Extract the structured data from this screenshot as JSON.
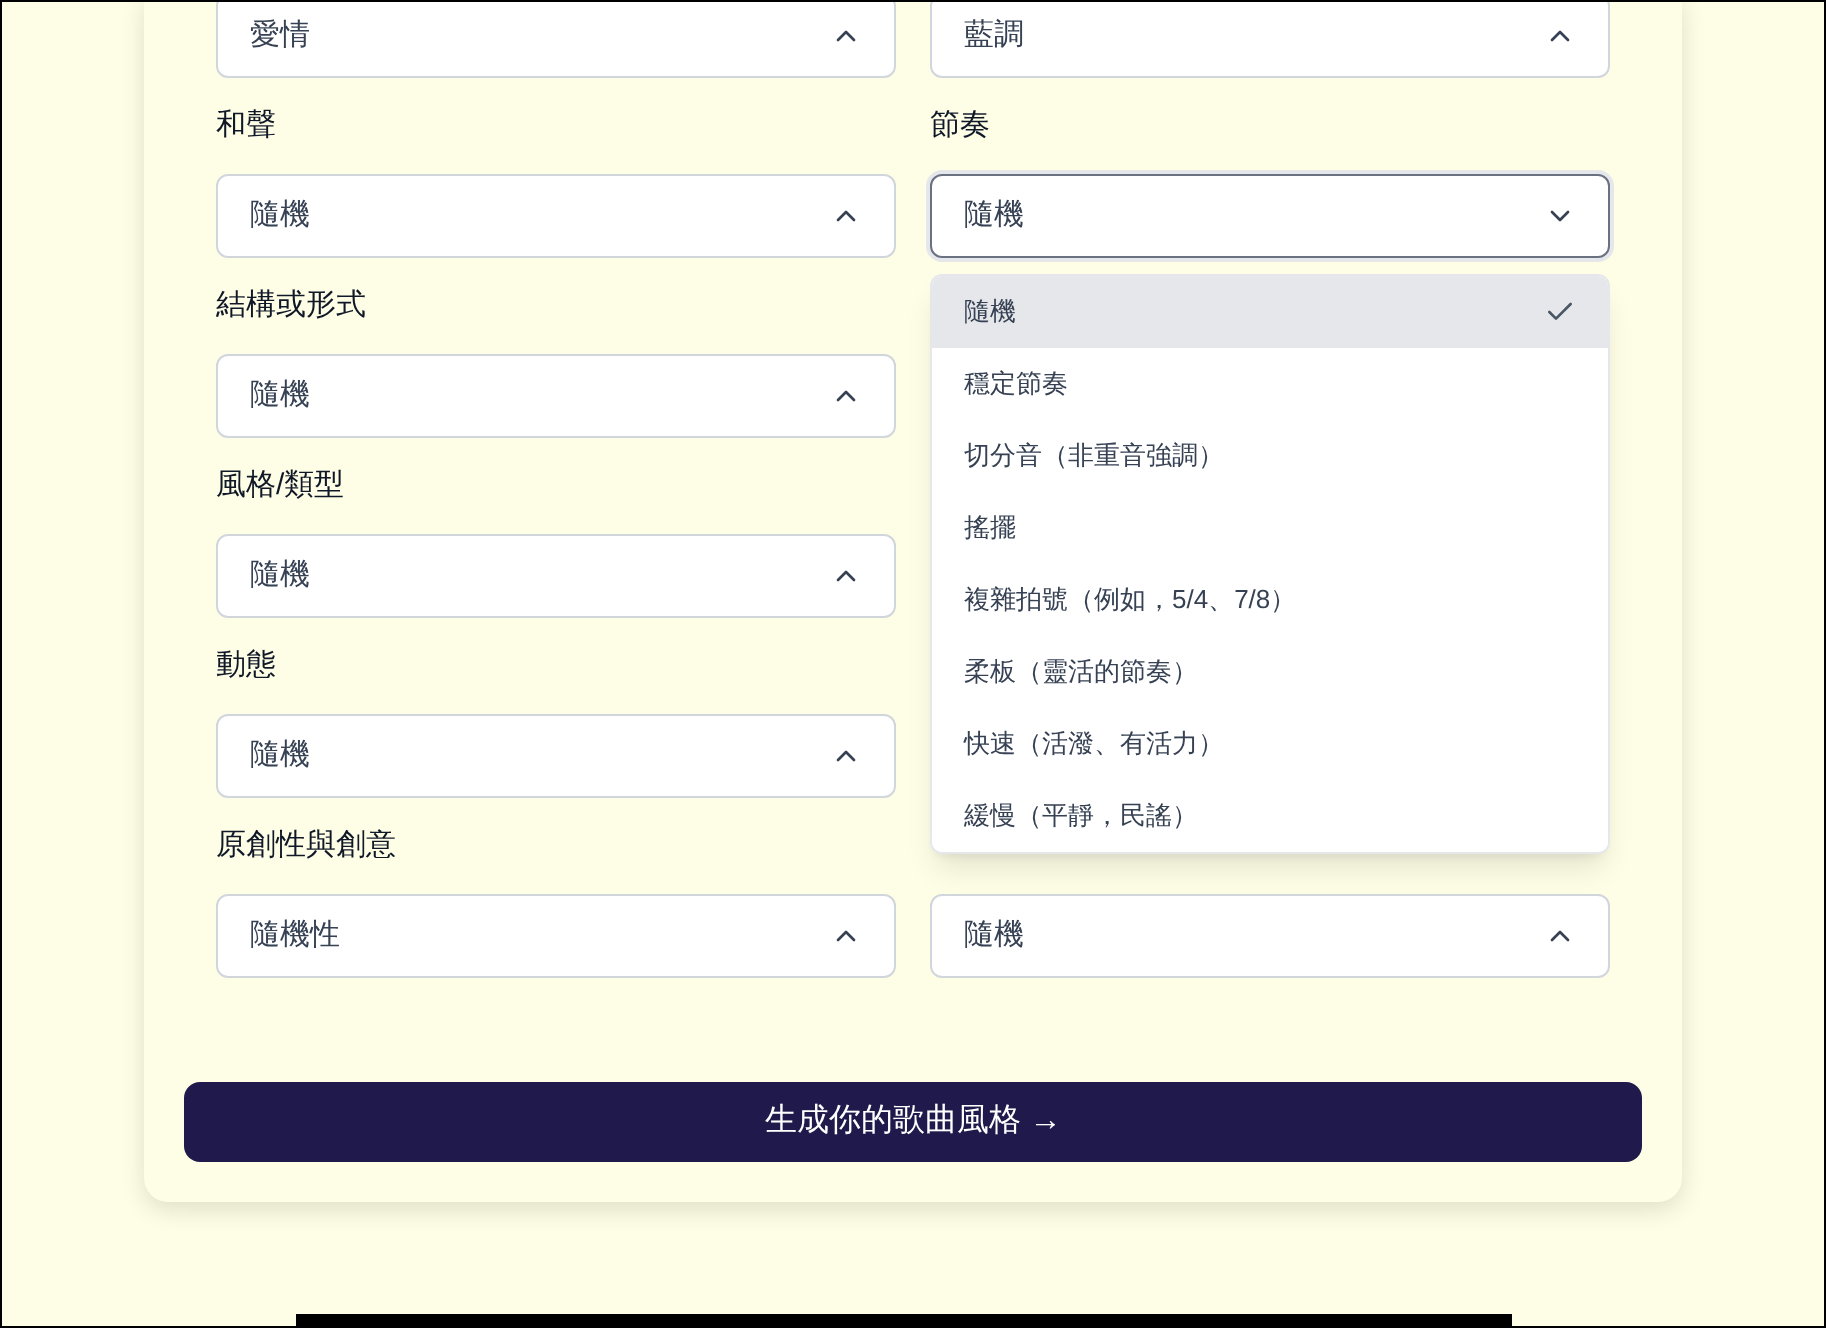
{
  "rows": [
    {
      "left": {
        "value": "愛情",
        "open": false
      },
      "right": {
        "value": "藍調",
        "open": false
      }
    },
    {
      "left": {
        "label": "和聲",
        "value": "隨機",
        "open": false
      },
      "right": {
        "label": "節奏",
        "value": "隨機",
        "open": true,
        "options": [
          {
            "label": "隨機",
            "selected": true
          },
          {
            "label": "穩定節奏",
            "selected": false
          },
          {
            "label": "切分音（非重音強調）",
            "selected": false
          },
          {
            "label": "搖擺",
            "selected": false
          },
          {
            "label": "複雜拍號（例如，5/4、7/8）",
            "selected": false
          },
          {
            "label": "柔板（靈活的節奏）",
            "selected": false
          },
          {
            "label": "快速（活潑、有活力）",
            "selected": false
          },
          {
            "label": "緩慢（平靜，民謠）",
            "selected": false
          }
        ]
      }
    },
    {
      "left": {
        "label": "結構或形式",
        "value": "隨機",
        "open": false
      }
    },
    {
      "left": {
        "label": "風格/類型",
        "value": "隨機",
        "open": false
      }
    },
    {
      "left": {
        "label": "動態",
        "value": "隨機",
        "open": false
      }
    },
    {
      "left": {
        "label": "原創性與創意",
        "value": "隨機性",
        "open": false
      },
      "right": {
        "value": "隨機",
        "open": false
      }
    }
  ],
  "submit": "生成你的歌曲風格 →"
}
